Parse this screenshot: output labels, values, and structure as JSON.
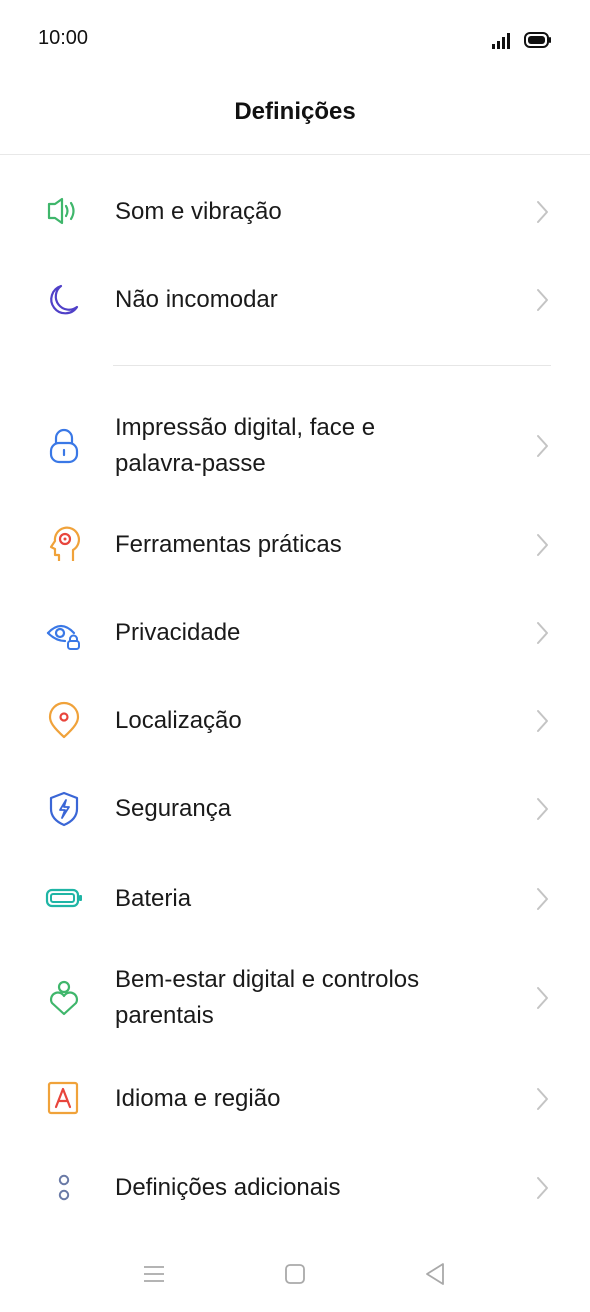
{
  "status_bar": {
    "time": "10:00",
    "signal_icon": "signal-icon",
    "battery_icon": "battery-full-icon"
  },
  "header": {
    "title": "Definições"
  },
  "settings": {
    "items": [
      {
        "label": "Som e vibração",
        "icon": "speaker-icon",
        "color": "#3fb66b"
      },
      {
        "label": "Não incomodar",
        "icon": "moon-icon",
        "color": "#5040c8"
      },
      {
        "label": "Impressão digital, face e palavra-passe",
        "icon": "lock-icon",
        "color": "#3a78e6"
      },
      {
        "label": "Ferramentas práticas",
        "icon": "head-gear-icon",
        "color": "#f0a23a"
      },
      {
        "label": "Privacidade",
        "icon": "eye-lock-icon",
        "color": "#3a78e6"
      },
      {
        "label": "Localização",
        "icon": "location-pin-icon",
        "color": "#f0a23a"
      },
      {
        "label": "Segurança",
        "icon": "shield-bolt-icon",
        "color": "#3a66d6"
      },
      {
        "label": "Bateria",
        "icon": "battery-icon",
        "color": "#1fb5a5"
      },
      {
        "label": "Bem-estar digital e controlos parentais",
        "icon": "person-heart-icon",
        "color": "#3fb66b"
      },
      {
        "label": "Idioma e região",
        "icon": "language-a-icon",
        "color": "#f0a23a"
      },
      {
        "label": "Definições adicionais",
        "icon": "dots-vertical-icon",
        "color": "#6a7aa6"
      }
    ]
  },
  "nav_bar": {
    "menu_icon": "menu-icon",
    "home_icon": "home-square-icon",
    "back_icon": "back-triangle-icon"
  }
}
